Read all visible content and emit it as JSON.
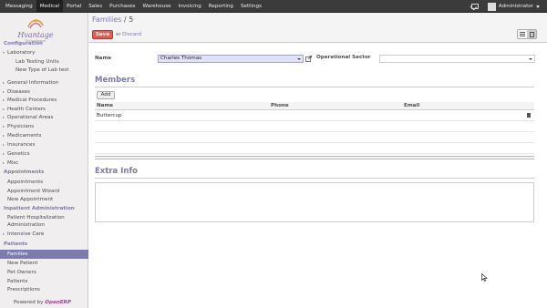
{
  "topbar": {
    "menu": [
      "Messaging",
      "Medical",
      "Portal",
      "Sales",
      "Purchases",
      "Warehouse",
      "Invoicing",
      "Reporting",
      "Settings"
    ],
    "active": "Medical",
    "user": "Administrator",
    "icons": [
      "mail-icon",
      "avatar",
      "chevron-down-icon"
    ]
  },
  "logo": {
    "name": "Hvantage",
    "tagline": "Technologies"
  },
  "sidebar": {
    "configuration_header": "Configuration",
    "laboratory": "Laboratory",
    "lab_testing_units": "Lab Testing Units",
    "new_type_lab_test": "New Type of Lab test",
    "general_information": "General Information",
    "diseases": "Diseases",
    "medical_procedures": "Medical Procedures",
    "health_centers": "Health Centers",
    "operational_areas": "Operational Areas",
    "physicians": "Physicians",
    "medicaments": "Medicaments",
    "insurances": "Insurances",
    "genetics": "Genetics",
    "misc": "Misc",
    "appointments_header": "Appointments",
    "appointments": "Appointments",
    "appointment_wizard": "Appointment Wizard",
    "new_appointment": "New Appointment",
    "inpatient_header": "Inpatient Administration",
    "patient_hospitalization_1": "Patient Hospitalization",
    "patient_hospitalization_2": "Administration",
    "intensive_care": "Intensive Care",
    "patients_header": "Patients",
    "families": "Families",
    "new_patient": "New Patient",
    "pet_owners": "Pet Owners",
    "patients": "Patients",
    "prescriptions": "Prescriptions",
    "powered_by": "Powered by",
    "openerp": "OpenERP"
  },
  "header": {
    "breadcrumb_parent": "Families",
    "breadcrumb_sep": " / ",
    "breadcrumb_current": "5",
    "save_label": "Save",
    "or_label": "or",
    "discard_label": "Discard"
  },
  "form": {
    "name_label": "Name",
    "name_value": "Charles Thomas",
    "sector_label": "Operational Sector",
    "sector_value": "",
    "members_title": "Members",
    "add_label": "Add",
    "columns": [
      "Name",
      "Phone",
      "Email"
    ],
    "rows": [
      {
        "name": "Buttercup",
        "phone": "",
        "email": ""
      }
    ],
    "extra_title": "Extra Info",
    "extra_value": ""
  },
  "colors": {
    "accent": "#7c7bad",
    "save": "#dc5f59",
    "topbar": "#3b3b3b",
    "sidebar": "#f0eeee",
    "input_highlight": "#e0e2f8"
  }
}
